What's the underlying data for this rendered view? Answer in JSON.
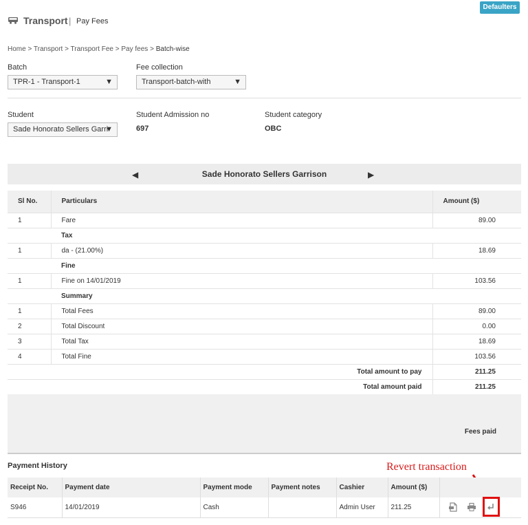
{
  "header": {
    "title": "Transport",
    "separator": "|",
    "subtitle": "Pay Fees",
    "defaulters_label": "Defaulters"
  },
  "breadcrumb": {
    "items": [
      "Home",
      "Transport",
      "Transport Fee",
      "Pay fees",
      "Batch-wise"
    ],
    "sep": " > "
  },
  "filters": {
    "batch_label": "Batch",
    "batch_value": "TPR-1 - Transport-1",
    "fee_collection_label": "Fee collection",
    "fee_collection_value": "Transport-batch-with",
    "student_label": "Student",
    "student_value": "Sade Honorato Sellers Garri",
    "admission_label": "Student Admission no",
    "admission_value": "697",
    "category_label": "Student category",
    "category_value": "OBC"
  },
  "student_nav": {
    "name": "Sade Honorato Sellers Garrison",
    "prev": "◀",
    "next": "▶"
  },
  "fees_table": {
    "headers": [
      "Sl No.",
      "Particulars",
      "Amount ($)"
    ],
    "rows": [
      {
        "type": "row",
        "sl": "1",
        "particular": "Fare",
        "amount": "89.00"
      },
      {
        "type": "section",
        "label": "Tax"
      },
      {
        "type": "row",
        "sl": "1",
        "particular": "da - (21.00%)",
        "amount": "18.69"
      },
      {
        "type": "section",
        "label": "Fine"
      },
      {
        "type": "row",
        "sl": "1",
        "particular": "Fine on 14/01/2019",
        "amount": "103.56"
      },
      {
        "type": "section",
        "label": "Summary"
      },
      {
        "type": "row",
        "sl": "1",
        "particular": "Total Fees",
        "amount": "89.00"
      },
      {
        "type": "row",
        "sl": "2",
        "particular": "Total Discount",
        "amount": "0.00"
      },
      {
        "type": "row",
        "sl": "3",
        "particular": "Total Tax",
        "amount": "18.69"
      },
      {
        "type": "row",
        "sl": "4",
        "particular": "Total Fine",
        "amount": "103.56"
      }
    ],
    "totals": [
      {
        "label": "Total amount to pay",
        "amount": "211.25"
      },
      {
        "label": "Total amount paid",
        "amount": "211.25"
      }
    ]
  },
  "fees_paid_label": "Fees paid",
  "payment_history": {
    "title": "Payment History",
    "headers": [
      "Receipt No.",
      "Payment date",
      "Payment mode",
      "Payment notes",
      "Cashier",
      "Amount ($)",
      ""
    ],
    "rows": [
      {
        "receipt": "S946",
        "date": "14/01/2019",
        "mode": "Cash",
        "notes": "",
        "cashier": "Admin User",
        "amount": "211.25"
      }
    ],
    "actions": [
      "pdf-icon",
      "print-icon",
      "revert-icon"
    ]
  },
  "annotation": {
    "text": "Revert transaction",
    "color": "#d81b1b"
  },
  "colors": {
    "accent": "#3aa4c6",
    "highlight": "#e01010"
  }
}
